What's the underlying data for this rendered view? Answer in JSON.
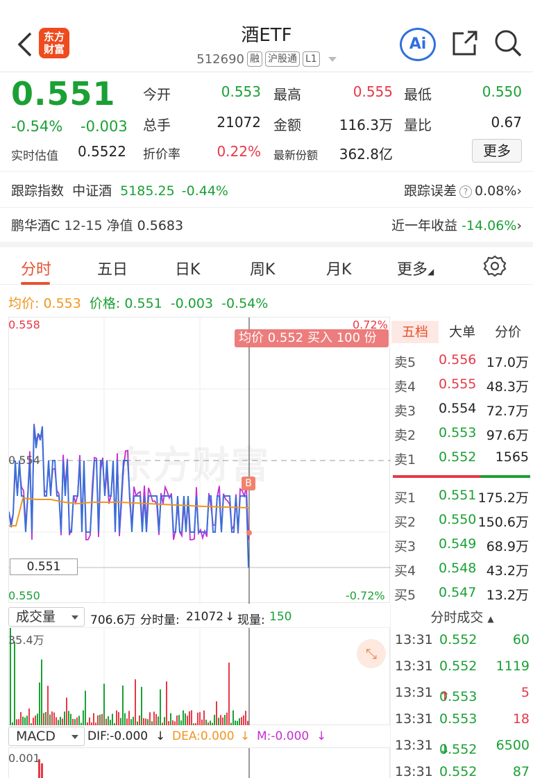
{
  "header": {
    "logo_line1": "东方",
    "logo_line2": "财富",
    "title": "酒ETF",
    "code": "512690",
    "tags": [
      "融",
      "沪股通",
      "L1"
    ],
    "ai_label": "Ai"
  },
  "quote": {
    "price": "0.551",
    "change_pct": "-0.54%",
    "change": "-0.003",
    "realtime_est_label": "实时估值",
    "realtime_est": "0.5522",
    "grid": [
      {
        "label": "今开",
        "value": "0.553",
        "color": "green"
      },
      {
        "label": "最高",
        "value": "0.555",
        "color": "red"
      },
      {
        "label": "最低",
        "value": "0.550",
        "color": "green"
      },
      {
        "label": "总手",
        "value": "21072",
        "color": "black"
      },
      {
        "label": "金额",
        "value": "116.3万",
        "color": "black"
      },
      {
        "label": "量比",
        "value": "0.67",
        "color": "black"
      },
      {
        "label": "折价率",
        "value": "0.22%",
        "color": "red"
      },
      {
        "label": "最新份额",
        "value": "362.8亿",
        "color": "black"
      }
    ],
    "more_button": "更多"
  },
  "tracking": {
    "label": "跟踪指数",
    "index_name": "中证酒",
    "index_value": "5185.25",
    "index_change": "-0.44%",
    "error_label": "跟踪误差",
    "error_value": "0.08%"
  },
  "fund": {
    "name": "鹏华酒C",
    "nav_text": "12-15 净值",
    "nav_value": "0.5683",
    "year_label": "近一年收益",
    "year_value": "-14.06%"
  },
  "tabs": [
    "分时",
    "五日",
    "日K",
    "周K",
    "月K",
    "更多"
  ],
  "active_tab": "分时",
  "avg_line": {
    "avg_label": "均价:",
    "avg_value": "0.553",
    "price_label": "价格:",
    "price_value": "0.551",
    "change": "-0.003",
    "change_pct": "-0.54%"
  },
  "chart": {
    "y_top": "0.558",
    "y_mid": "0.554",
    "y_bottom": "0.550",
    "pct_top": "0.72%",
    "pct_bottom": "-0.72%",
    "tooltip": "均价 0.552 买入 100 份",
    "price_box": "0.551",
    "watermark": "东方财富",
    "b_marker": "B",
    "price_color": "#3a6fd8",
    "avg_color": "#f0951f",
    "iopv_color": "#c42fd1"
  },
  "orderbook": {
    "tabs": [
      "五档",
      "大单",
      "分价"
    ],
    "asks": [
      {
        "label": "卖5",
        "price": "0.556",
        "vol": "17.0万",
        "color": "red"
      },
      {
        "label": "卖4",
        "price": "0.555",
        "vol": "48.3万",
        "color": "red"
      },
      {
        "label": "卖3",
        "price": "0.554",
        "vol": "72.7万",
        "color": "black"
      },
      {
        "label": "卖2",
        "price": "0.553",
        "vol": "97.6万",
        "color": "green"
      },
      {
        "label": "卖1",
        "price": "0.552",
        "vol": "1565",
        "color": "green"
      }
    ],
    "bids": [
      {
        "label": "买1",
        "price": "0.551",
        "vol": "175.2万",
        "color": "green"
      },
      {
        "label": "买2",
        "price": "0.550",
        "vol": "150.6万",
        "color": "green"
      },
      {
        "label": "买3",
        "price": "0.549",
        "vol": "68.9万",
        "color": "green"
      },
      {
        "label": "买4",
        "price": "0.548",
        "vol": "43.2万",
        "color": "green"
      },
      {
        "label": "买5",
        "price": "0.547",
        "vol": "13.2万",
        "color": "green"
      }
    ]
  },
  "volume": {
    "selector": "成交量",
    "total": "706.6万",
    "period_label": "分时量:",
    "period_value": "21072",
    "now_label": "现量:",
    "now_value": "150",
    "y_max": "35.4万"
  },
  "macd": {
    "selector": "MACD",
    "dif": "DIF:-0.000",
    "dea": "DEA:0.000",
    "m": "M:-0.000",
    "y_top": "0.001"
  },
  "trades": {
    "header": "分时成交",
    "rows": [
      {
        "time": "13:31",
        "price": "0.552",
        "vol": "60",
        "arrow": ""
      },
      {
        "time": "13:31",
        "price": "0.552",
        "vol": "1119",
        "arrow": ""
      },
      {
        "time": "13:31",
        "price": "0.553",
        "vol": "5",
        "arrow": "↑"
      },
      {
        "time": "13:31",
        "price": "0.553",
        "vol": "18",
        "arrow": ""
      },
      {
        "time": "13:31",
        "price": "0.552",
        "vol": "6500",
        "arrow": "↓"
      },
      {
        "time": "13:31",
        "price": "0.552",
        "vol": "87",
        "arrow": ""
      }
    ]
  }
}
